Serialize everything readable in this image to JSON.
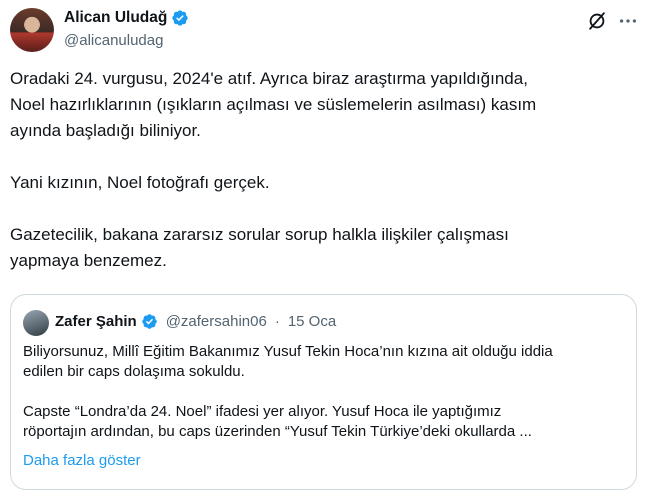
{
  "author": {
    "name": "Alican Uludağ",
    "handle": "@alicanuludag"
  },
  "tweet": {
    "text": "Oradaki 24. vurgusu, 2024'e atıf. Ayrıca biraz araştırma yapıldığında,\nNoel hazırlıklarının (ışıkların açılması ve süslemelerin asılması) kasım\nayında başladığı biliniyor.\n\nYani kızının, Noel fotoğrafı gerçek.\n\nGazetecilik, bakana zararsız sorular sorup halkla ilişkiler çalışması\nyapmaya benzemez."
  },
  "quote": {
    "name": "Zafer Şahin",
    "handle": "@zafersahin06",
    "separator": "·",
    "date": "15 Oca",
    "text": "Biliyorsunuz, Millî Eğitim Bakanımız Yusuf Tekin Hoca’nın kızına ait olduğu iddia\nedilen bir caps dolaşıma sokuldu.\n\nCapste “Londra’da 24. Noel” ifadesi yer alıyor. Yusuf Hoca ile yaptığımız\nröportajın ardından, bu caps üzerinden “Yusuf Tekin Türkiye’deki okullarda ...",
    "show_more": "Daha fazla göster"
  },
  "icons": {
    "verified": "verified-badge-icon",
    "grok": "grok-icon",
    "more": "more-options-icon"
  },
  "colors": {
    "verified": "#1d9bf0",
    "link": "#1d9bf0",
    "secondary_text": "#536471",
    "border": "#cfd9de"
  }
}
